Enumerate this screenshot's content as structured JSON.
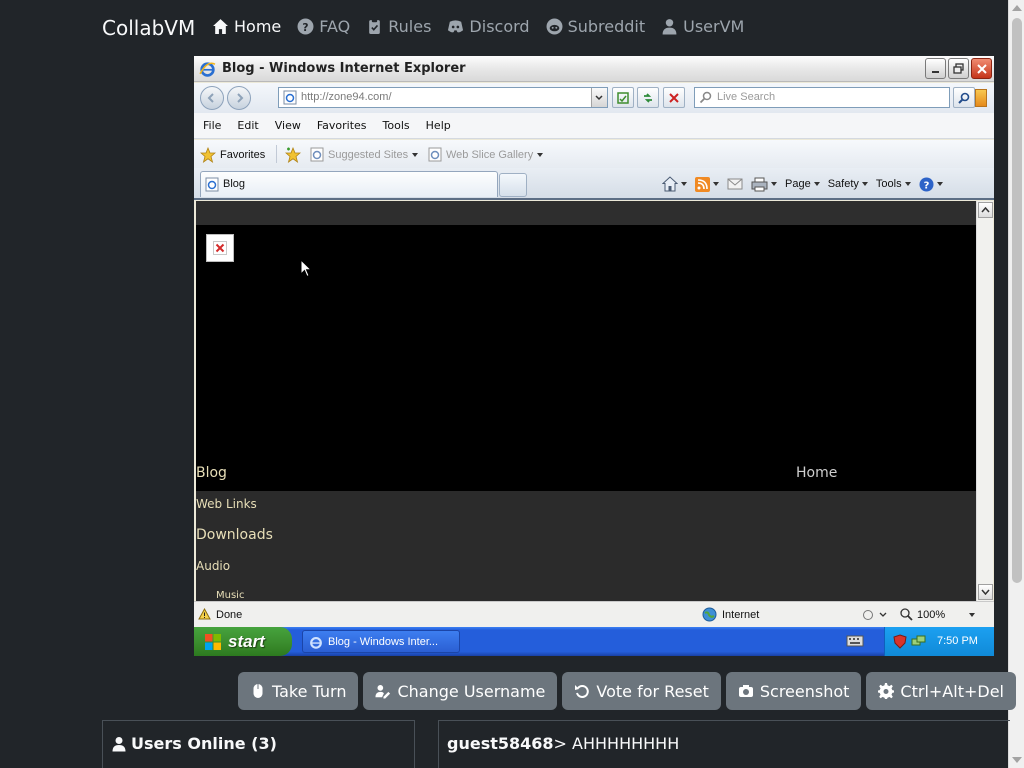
{
  "navbar": {
    "brand": "CollabVM",
    "links": [
      {
        "label": "Home",
        "icon": "home-icon",
        "active": true
      },
      {
        "label": "FAQ",
        "icon": "question-circle-icon"
      },
      {
        "label": "Rules",
        "icon": "clipboard-icon"
      },
      {
        "label": "Discord",
        "icon": "discord-icon"
      },
      {
        "label": "Subreddit",
        "icon": "reddit-icon"
      },
      {
        "label": "UserVM",
        "icon": "user-icon"
      }
    ]
  },
  "vm": {
    "window_title": "Blog - Windows Internet Explorer",
    "address": "http://zone94.com/",
    "search_placeholder": "Live Search",
    "menu": [
      "File",
      "Edit",
      "View",
      "Favorites",
      "Tools",
      "Help"
    ],
    "favorites_bar": {
      "favorites": "Favorites",
      "suggested_sites": "Suggested Sites",
      "web_slice_gallery": "Web Slice Gallery"
    },
    "tab_label": "Blog",
    "command_bar": {
      "page": "Page",
      "safety": "Safety",
      "tools": "Tools"
    },
    "site": {
      "nav_blog": "Blog",
      "nav_home": "Home",
      "web_links": "Web Links",
      "downloads": "Downloads",
      "audio": "Audio",
      "music": "Music"
    },
    "status": {
      "text": "Done",
      "zone": "Internet",
      "zoom": "100%"
    },
    "taskbar": {
      "start": "start",
      "task": "Blog - Windows Inter...",
      "clock": "7:50 PM"
    }
  },
  "controls": [
    {
      "label": "Take Turn",
      "icon": "mouse-icon"
    },
    {
      "label": "Change Username",
      "icon": "user-edit-icon"
    },
    {
      "label": "Vote for Reset",
      "icon": "undo-icon"
    },
    {
      "label": "Screenshot",
      "icon": "camera-icon"
    },
    {
      "label": "Ctrl+Alt+Del",
      "icon": "gear-icon"
    }
  ],
  "users": {
    "title": "Users Online (3)"
  },
  "chat": {
    "username": "guest58468",
    "separator": ">",
    "message": " AHHHHHHHH"
  },
  "colors": {
    "background": "#212529",
    "button": "#6c757d",
    "site_text": "#e8dfb8"
  }
}
